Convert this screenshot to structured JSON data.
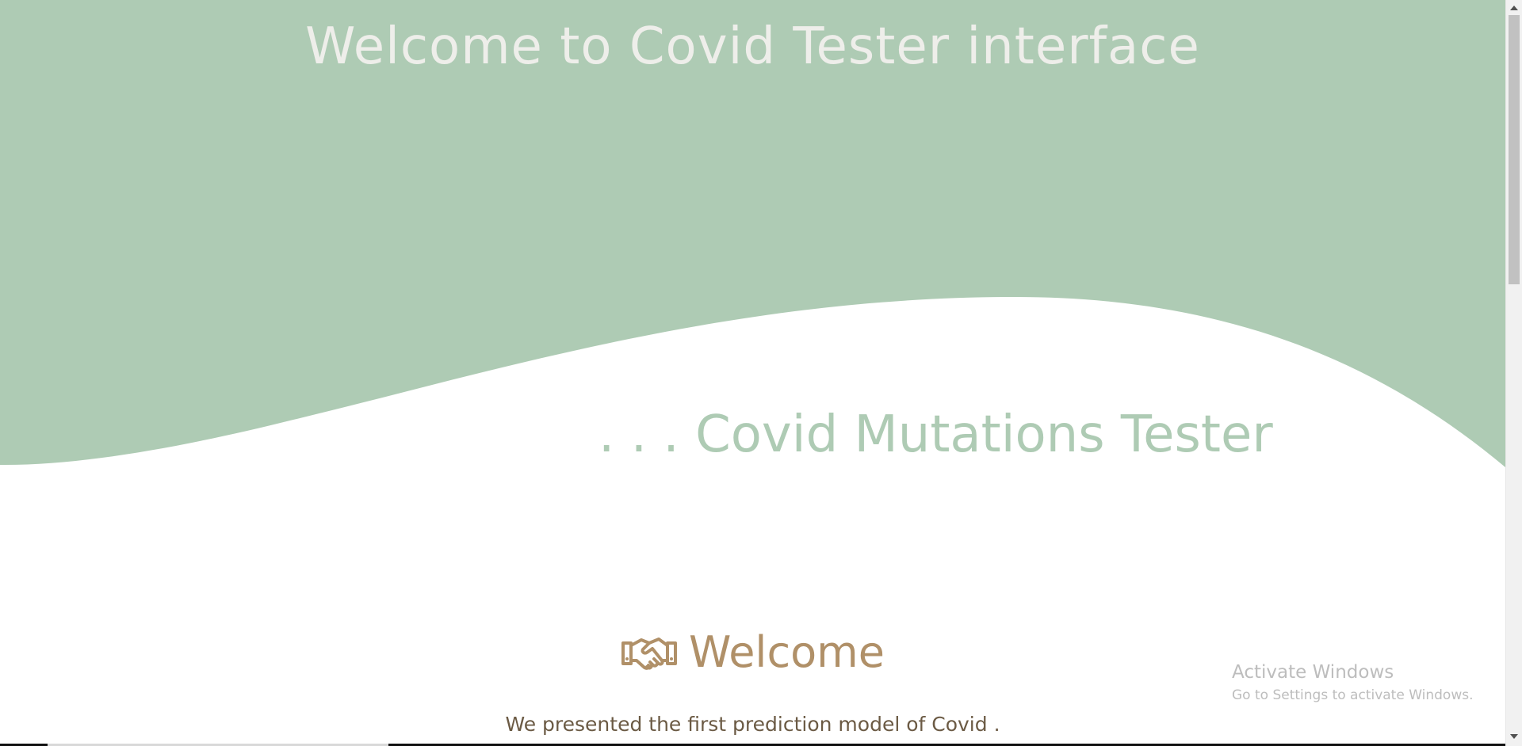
{
  "header": {
    "title": "Welcome to Covid Tester interface"
  },
  "hero": {
    "tagline": ". . . Covid Mutations Tester"
  },
  "welcome": {
    "icon": "handshake-icon",
    "heading": "Welcome",
    "text": "We presented the first prediction model of Covid ."
  },
  "watermark": {
    "title": "Activate Windows",
    "subtitle": "Go to Settings to activate Windows."
  },
  "colors": {
    "hero_green": "#aecbb4",
    "title_white": "#eeeeea",
    "accent_brown": "#b09068",
    "text_brown": "#6b5a44"
  }
}
